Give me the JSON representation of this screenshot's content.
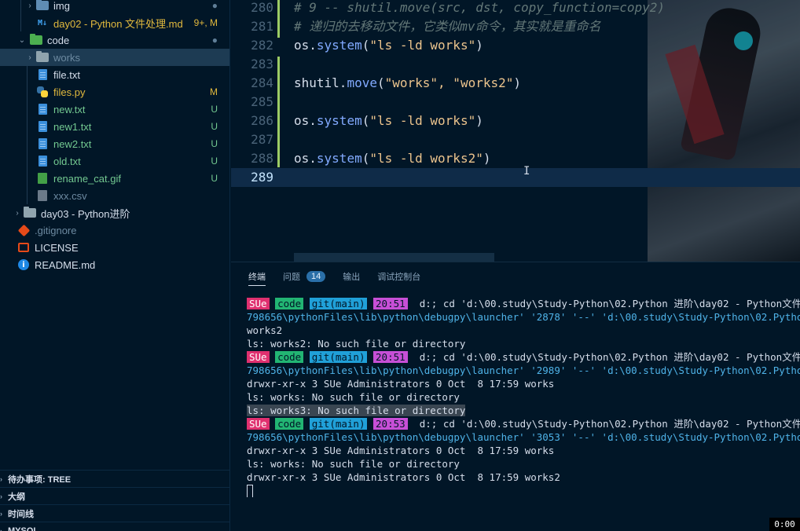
{
  "sidebar": {
    "items": [
      {
        "label": "img",
        "icon": "folder-icon",
        "badge": "●",
        "color": "#d6deeb",
        "badge_color": "#5f7e97"
      },
      {
        "label": "day02 - Python 文件处理.md",
        "icon": "markdown-icon",
        "badge": "9+, M",
        "color": "#e2b93d",
        "badge_color": "#e2b93d"
      },
      {
        "label": "code",
        "icon": "folder-open-icon",
        "badge": "●",
        "color": "#d6deeb",
        "badge_color": "#5f7e97"
      },
      {
        "label": "works",
        "icon": "folder-icon",
        "badge": "",
        "color": "#6d8aa1",
        "badge_color": ""
      },
      {
        "label": "file.txt",
        "icon": "file-icon",
        "badge": "",
        "color": "#d6deeb",
        "badge_color": ""
      },
      {
        "label": "files.py",
        "icon": "python-icon",
        "badge": "M",
        "color": "#e2b93d",
        "badge_color": "#e2b93d"
      },
      {
        "label": "new.txt",
        "icon": "file-icon",
        "badge": "U",
        "color": "#73c991",
        "badge_color": "#73c991"
      },
      {
        "label": "new1.txt",
        "icon": "file-icon",
        "badge": "U",
        "color": "#73c991",
        "badge_color": "#73c991"
      },
      {
        "label": "new2.txt",
        "icon": "file-icon",
        "badge": "U",
        "color": "#73c991",
        "badge_color": "#73c991"
      },
      {
        "label": "old.txt",
        "icon": "file-icon",
        "badge": "U",
        "color": "#73c991",
        "badge_color": "#73c991"
      },
      {
        "label": "rename_cat.gif",
        "icon": "gif-icon",
        "badge": "U",
        "color": "#73c991",
        "badge_color": "#73c991"
      },
      {
        "label": "xxx.csv",
        "icon": "csv-icon",
        "badge": "",
        "color": "#6d8aa1",
        "badge_color": ""
      },
      {
        "label": "day03 - Python进阶",
        "icon": "folder-icon",
        "badge": "",
        "color": "#d6deeb",
        "badge_color": ""
      },
      {
        "label": ".gitignore",
        "icon": "git-icon",
        "badge": "",
        "color": "#6d8aa1",
        "badge_color": ""
      },
      {
        "label": "LICENSE",
        "icon": "license-icon",
        "badge": "",
        "color": "#d6deeb",
        "badge_color": ""
      },
      {
        "label": "README.md",
        "icon": "info-icon",
        "badge": "",
        "color": "#d6deeb",
        "badge_color": ""
      }
    ],
    "sections": [
      "待办事项: TREE",
      "大纲",
      "时间线",
      "MYSQL"
    ]
  },
  "editor": {
    "lines": [
      {
        "num": "280",
        "code": "# 9 -- shutil.move(src, dst, copy_function=copy2)",
        "kind": "comment"
      },
      {
        "num": "281",
        "code": "# 递归的去移动文件，它类似mv命令，其实就是重命名",
        "kind": "comment"
      },
      {
        "num": "282",
        "pre": "os.",
        "fn": "system",
        "open": "(",
        "str": "\"ls -ld works\"",
        "close": ")",
        "kind": "call"
      },
      {
        "num": "283",
        "code": "",
        "kind": "blank"
      },
      {
        "num": "284",
        "pre": "shutil.",
        "fn": "move",
        "open": "(",
        "str": "\"works\", \"works2\"",
        "close": ")",
        "kind": "call"
      },
      {
        "num": "285",
        "code": "",
        "kind": "blank"
      },
      {
        "num": "286",
        "pre": "os.",
        "fn": "system",
        "open": "(",
        "str": "\"ls -ld works\"",
        "close": ")",
        "kind": "call"
      },
      {
        "num": "287",
        "code": "",
        "kind": "blank"
      },
      {
        "num": "288",
        "pre": "os.",
        "fn": "system",
        "open": "(",
        "str": "\"ls -ld works2\"",
        "close": ")",
        "kind": "call"
      },
      {
        "num": "289",
        "code": "",
        "kind": "blank"
      }
    ]
  },
  "panel": {
    "tabs": [
      {
        "label": "终端",
        "active": true
      },
      {
        "label": "问题",
        "count": "14"
      },
      {
        "label": "输出"
      },
      {
        "label": "调试控制台"
      }
    ]
  },
  "terminal": {
    "prompt": {
      "user": "SUe",
      "dir": "code",
      "git": "git(main)"
    },
    "blocks": [
      {
        "time": "20:51",
        "cmd": "d:; cd 'd:\\00.study\\Study-Python\\02.Python 进阶\\day02 - Python文件",
        "cont": "798656\\pythonFiles\\lib\\python\\debugpy\\launcher' '2878' '--' 'd:\\00.study\\Study-Python\\02.Python 进阶\\",
        "out": [
          "works2",
          "ls: works2: No such file or directory"
        ]
      },
      {
        "time": "20:51",
        "cmd": "d:; cd 'd:\\00.study\\Study-Python\\02.Python 进阶\\day02 - Python文件",
        "cont": "798656\\pythonFiles\\lib\\python\\debugpy\\launcher' '2989' '--' 'd:\\00.study\\Study-Python\\02.Python 进阶\\",
        "out": [
          "drwxr-xr-x 3 SUe Administrators 0 Oct  8 17:59 works",
          "ls: works: No such file or directory",
          "ls: works3: No such file or directory"
        ]
      },
      {
        "time": "20:53",
        "cmd": "d:; cd 'd:\\00.study\\Study-Python\\02.Python 进阶\\day02 - Python文件",
        "cont": "798656\\pythonFiles\\lib\\python\\debugpy\\launcher' '3053' '--' 'd:\\00.study\\Study-Python\\02.Python 进阶\\",
        "out": [
          "drwxr-xr-x 3 SUe Administrators 0 Oct  8 17:59 works",
          "ls: works: No such file or directory",
          "drwxr-xr-x 3 SUe Administrators 0 Oct  8 17:59 works2"
        ]
      }
    ]
  },
  "overlay": {
    "timer": "0:00"
  }
}
